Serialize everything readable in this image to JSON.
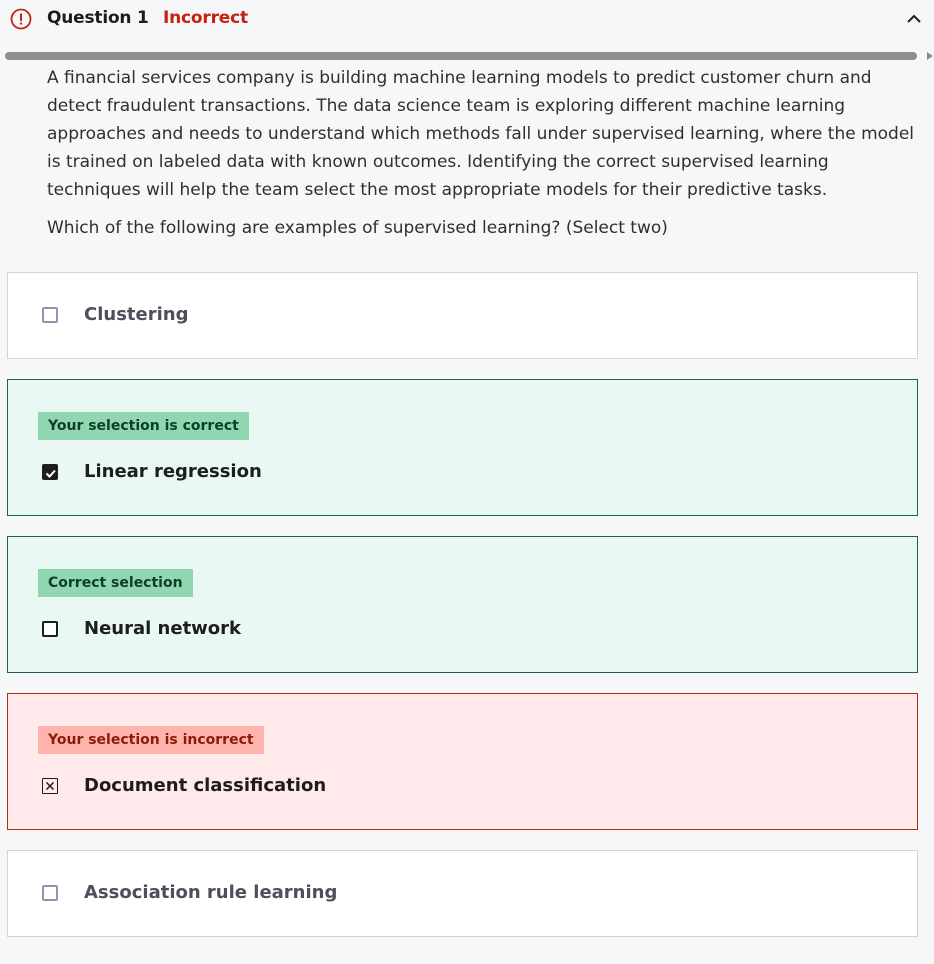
{
  "header": {
    "alert_icon": "alert-circle-icon",
    "title": "Question 1",
    "status": "Incorrect",
    "status_color": "#c4210e",
    "collapse_icon": "chevron-up-icon"
  },
  "question": {
    "prompt": "A financial services company is building machine learning models to predict customer churn and detect fraudulent transactions. The data science team is exploring different machine learning approaches and needs to understand which methods fall under supervised learning, where the model is trained on labeled data with known outcomes. Identifying the correct supervised learning techniques will help the team select the most appropriate models for their predictive tasks.",
    "ask": "Which of the following are examples of supervised learning? (Select two)"
  },
  "options": [
    {
      "label": "Clustering",
      "badge": "",
      "checked": false,
      "state": "neutral"
    },
    {
      "label": "Linear regression",
      "badge": "Your selection is correct",
      "checked": true,
      "state": "correct"
    },
    {
      "label": "Neural network",
      "badge": "Correct selection",
      "checked": false,
      "state": "missed"
    },
    {
      "label": "Document classification",
      "badge": "Your selection is incorrect",
      "checked": true,
      "state": "incorrect"
    },
    {
      "label": "Association rule learning",
      "badge": "",
      "checked": false,
      "state": "neutral"
    }
  ],
  "colors": {
    "correct_bg": "#e9f8f2",
    "correct_border": "#1e6055",
    "correct_badge": "#8fd6b1",
    "incorrect_bg": "#ffe9ea",
    "incorrect_border": "#b32d0f",
    "incorrect_badge": "#ffb3ad"
  }
}
